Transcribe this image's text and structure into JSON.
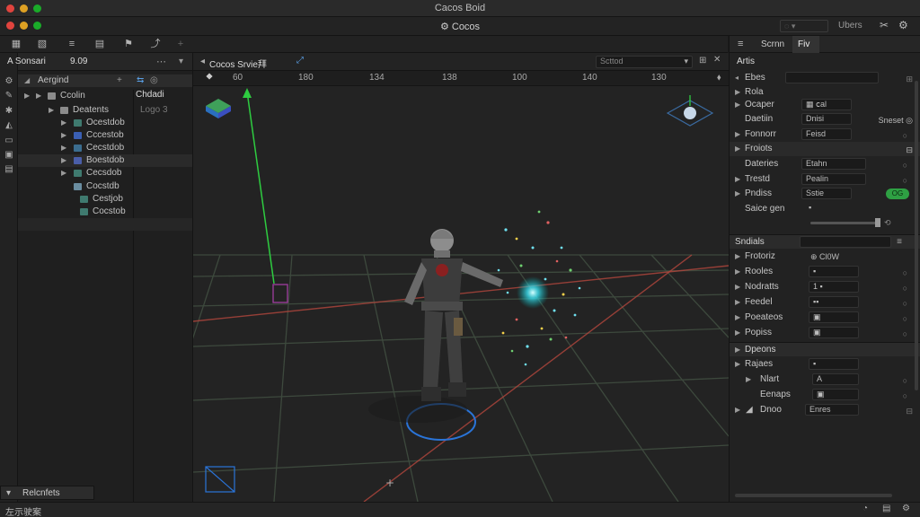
{
  "window": {
    "title": "Cacos Boid",
    "app_title": "Cocos"
  },
  "top_right": {
    "label": "Ubers"
  },
  "toolbar": {
    "icons": [
      "file-icon",
      "image-icon",
      "list-icon",
      "doc-icon",
      "flag-icon",
      "share-icon",
      "plus-icon"
    ]
  },
  "left_rail": {
    "icons": [
      "gear-icon",
      "pen-icon",
      "settings-icon",
      "triangle-icon",
      "square-icon",
      "window-icon",
      "box-icon"
    ]
  },
  "hierarchy": {
    "header_left": "A Sonsari",
    "header_value": "9.09",
    "title": "Aergind",
    "subheader": "Chdadi",
    "sub_value": "Logo 3",
    "items": [
      {
        "label": "Ccolin",
        "color": "#9b9b9b"
      },
      {
        "label": "Deatents",
        "color": "#9b9b9b"
      },
      {
        "label": "Ocestdob",
        "color": "#3f7a6f"
      },
      {
        "label": "Cccestob",
        "color": "#3a5fb3"
      },
      {
        "label": "Cecstdob",
        "color": "#3b6d8f"
      },
      {
        "label": "Boestdob",
        "color": "#4a5ea8"
      },
      {
        "label": "Cecsdob",
        "color": "#3f7a6f"
      },
      {
        "label": "Cocstdb",
        "color": "#6a8da0"
      },
      {
        "label": "Cestjob",
        "color": "#3f7a6f"
      },
      {
        "label": "Cocstob",
        "color": "#3f7a6f"
      }
    ],
    "footer": "Relcnfets"
  },
  "scene": {
    "tab_label": "Cocos Srvie拜",
    "search_placeholder": "Scttod",
    "ruler": [
      "60",
      "180",
      "134",
      "138",
      "100",
      "140",
      "130"
    ]
  },
  "inspector": {
    "tabs": [
      "Scrnn",
      "Fiv"
    ],
    "title": "Artis",
    "rows": [
      {
        "label": "Ebes",
        "value": "",
        "end": "⊞"
      },
      {
        "label": "Rola",
        "value": "",
        "end": ""
      },
      {
        "label": "Ocaper",
        "value": "▦ ⅽal",
        "end": ""
      },
      {
        "label": "Daetiin",
        "value": "Dnisi",
        "end": "Sneset ◎"
      },
      {
        "label": "Fonnorr",
        "value": "Feisd",
        "end": "○"
      },
      {
        "label": "Froiots",
        "value": "",
        "end": "⊟"
      },
      {
        "label": "Dateries",
        "value": "Etahn",
        "end": "○"
      },
      {
        "label": "Trestd",
        "value": "Pealin",
        "end": "○"
      },
      {
        "label": "Pndiss",
        "value": "Sstie",
        "end": ""
      },
      {
        "label": "Saice gen",
        "value": "▪",
        "end": ""
      }
    ],
    "section2_title": "Sndials",
    "rows2": [
      {
        "label": "Frotoriz",
        "value": "⊕ Cl0W",
        "end": ""
      },
      {
        "label": "Rooles",
        "value": "▪",
        "end": "○"
      },
      {
        "label": "Nodratts",
        "value": "1 ▪",
        "end": "○"
      },
      {
        "label": "Feedel",
        "value": "▪▪",
        "end": "○"
      },
      {
        "label": "Poeateos",
        "value": "▣",
        "end": "○"
      },
      {
        "label": "Popiss",
        "value": "▣",
        "end": "○"
      }
    ],
    "section3_title": "Dpeons",
    "rows3": [
      {
        "label": "Rajaes",
        "value": "▪",
        "end": ""
      },
      {
        "label": "Nlart",
        "value": "A",
        "end": "○"
      },
      {
        "label": "Eenaps",
        "value": "▣",
        "end": "○"
      },
      {
        "label": "Dnoo",
        "value": "Enres",
        "end": "⊟"
      }
    ],
    "toggle_label": "OG"
  },
  "statusbar": {
    "text": "左示驶案"
  },
  "colors": {
    "grid": "#3a4a3a",
    "x_axis": "#c0392b",
    "y_axis": "#2ecc40",
    "accent": "#2ea043"
  }
}
